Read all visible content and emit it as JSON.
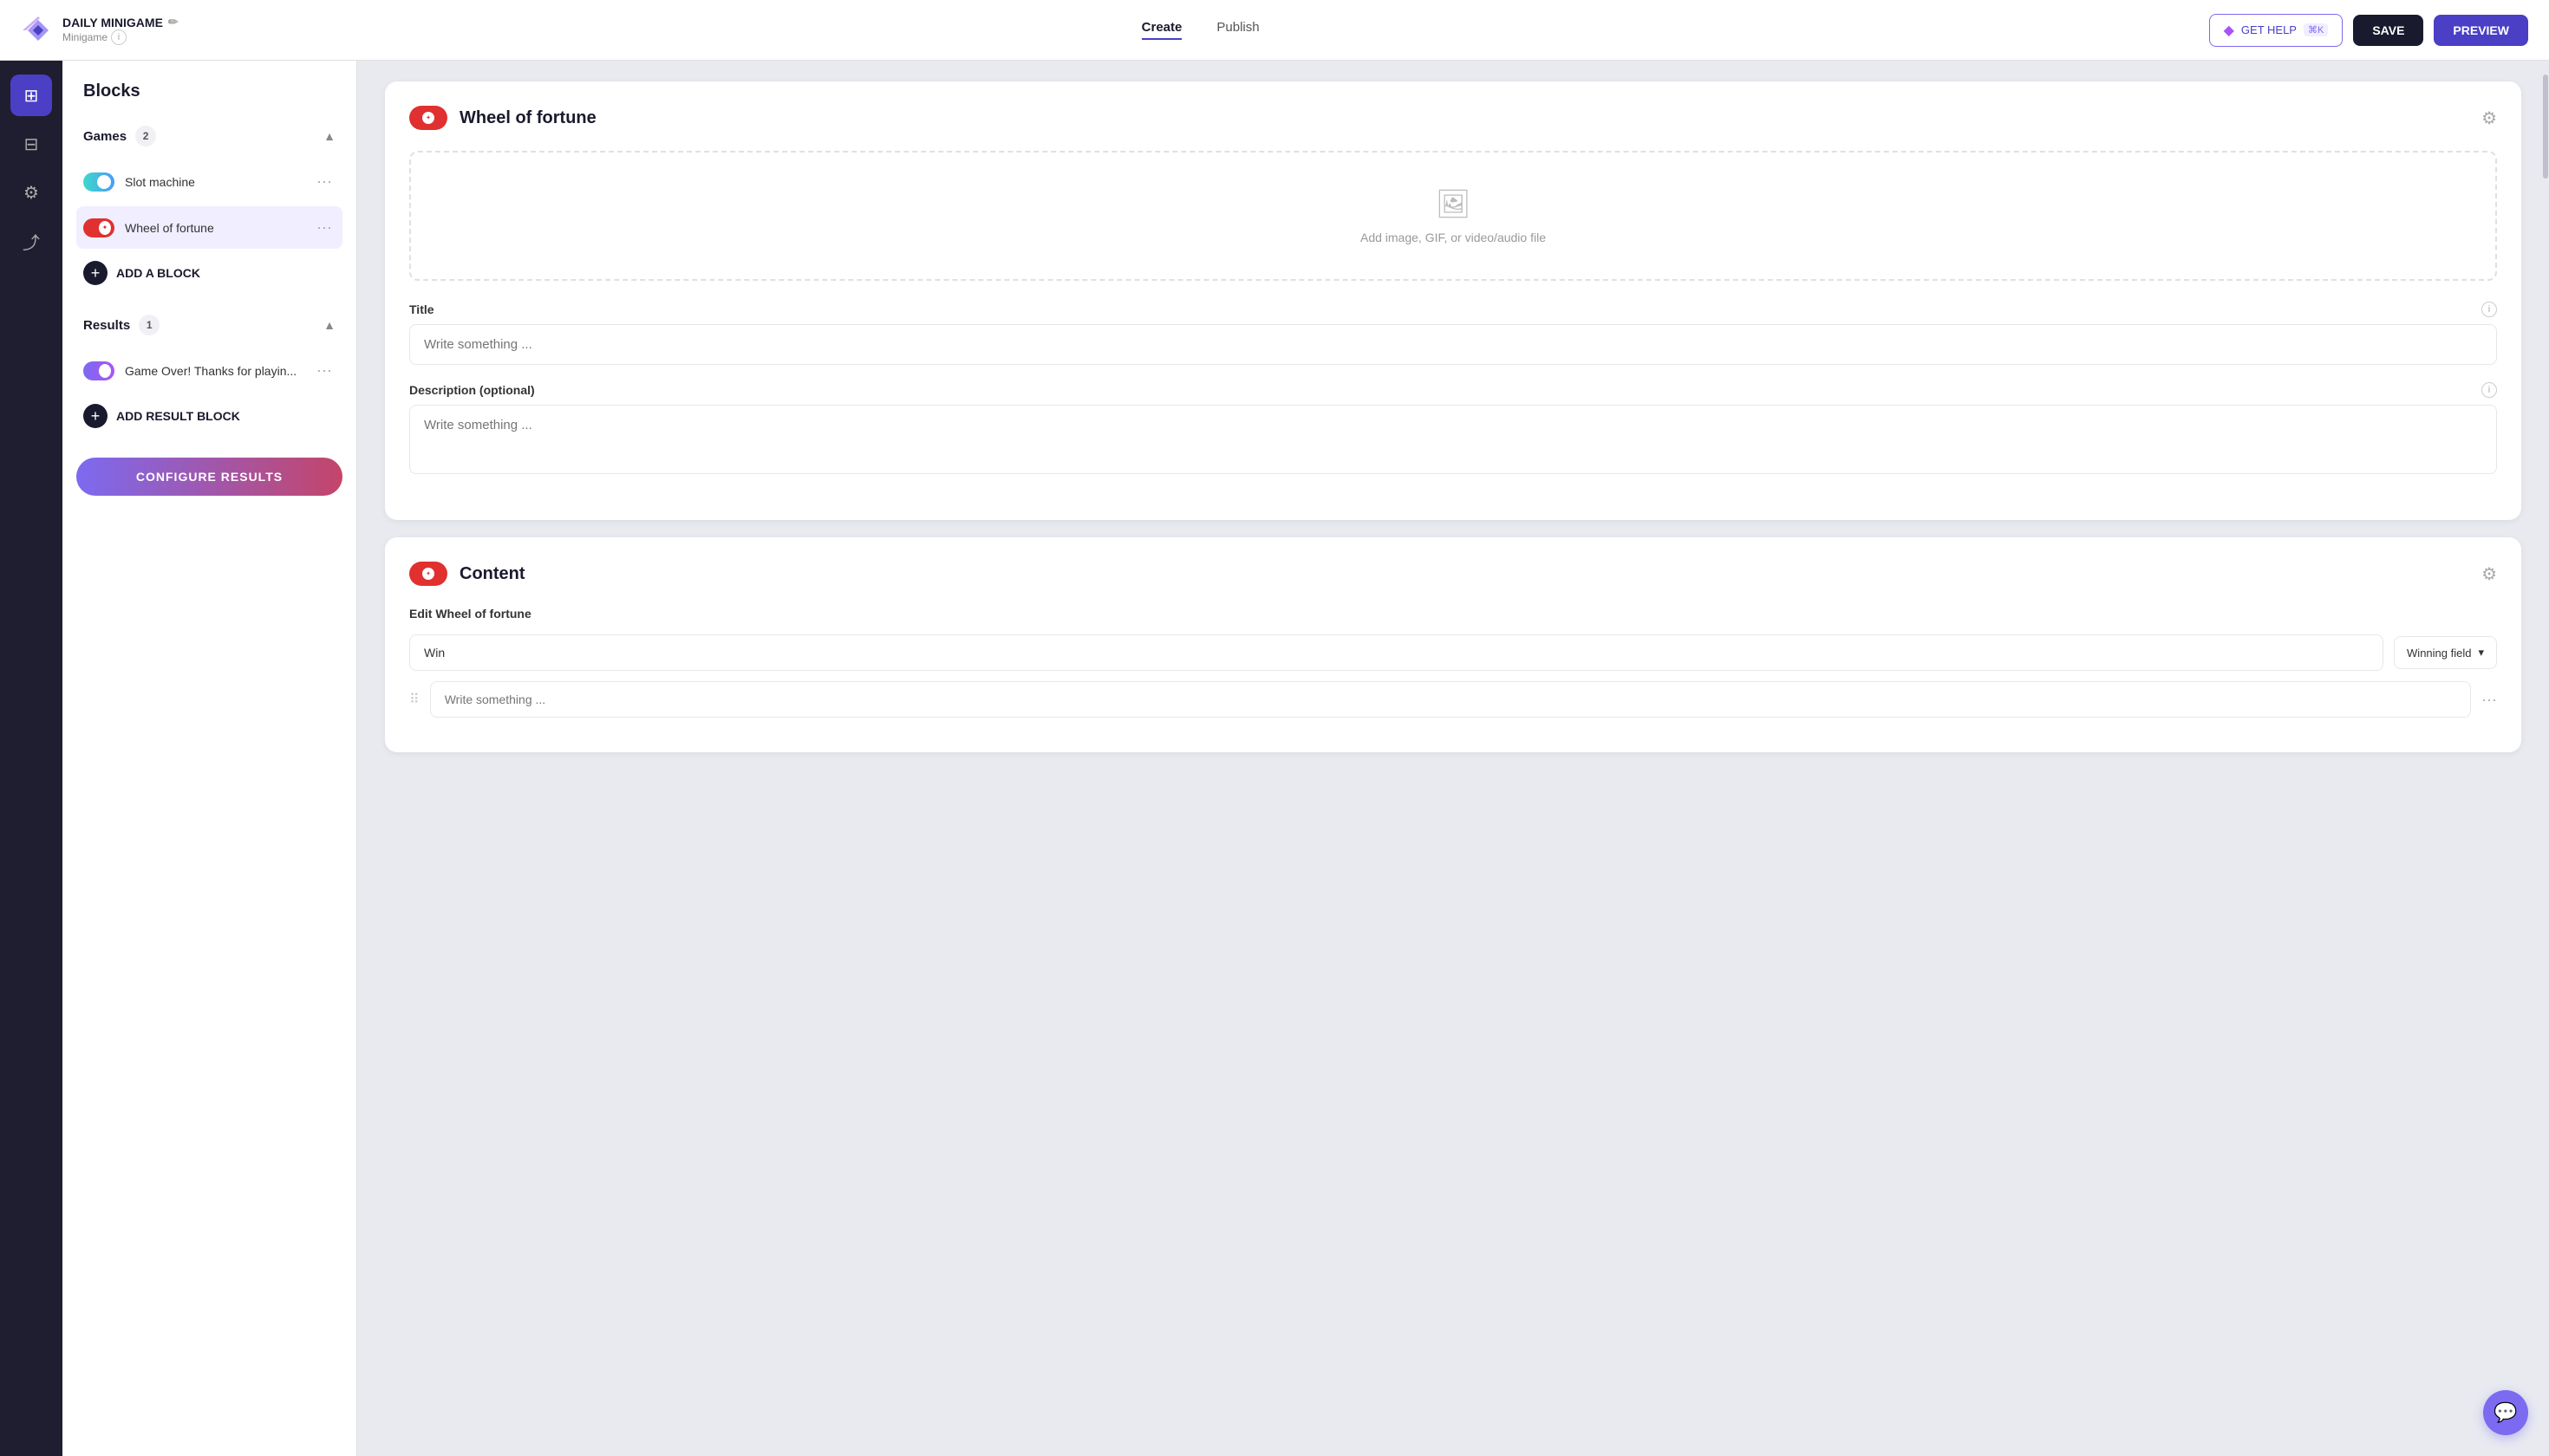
{
  "topbar": {
    "title": "DAILY MINIGAME",
    "subtitle": "Minigame",
    "create_label": "Create",
    "publish_label": "Publish",
    "help_label": "GET HELP",
    "help_shortcut": "⌘K",
    "save_label": "SAVE",
    "preview_label": "PREVIEW"
  },
  "sidebar_icons": [
    {
      "name": "blocks-icon",
      "symbol": "⊞",
      "active": true
    },
    {
      "name": "layers-icon",
      "symbol": "⊟",
      "active": false
    },
    {
      "name": "settings-icon",
      "symbol": "⚙",
      "active": false
    },
    {
      "name": "share-icon",
      "symbol": "⤴",
      "active": false
    }
  ],
  "blocks_panel": {
    "title": "Blocks",
    "games_section": {
      "label": "Games",
      "count": "2",
      "items": [
        {
          "label": "Slot machine",
          "type": "slot"
        },
        {
          "label": "Wheel of fortune",
          "type": "wheel",
          "active": true
        }
      ],
      "add_label": "ADD A BLOCK"
    },
    "results_section": {
      "label": "Results",
      "count": "1",
      "items": [
        {
          "label": "Game Over! Thanks for playin...",
          "type": "result"
        }
      ],
      "add_label": "ADD RESULT BLOCK"
    },
    "configure_label": "CONFIGURE RESULTS"
  },
  "wheel_card": {
    "title": "Wheel of fortune",
    "upload_text": "Add image, GIF, or video/audio file",
    "title_field": {
      "label": "Title",
      "placeholder": "Write something ..."
    },
    "description_field": {
      "label": "Description (optional)",
      "placeholder": "Write something ..."
    }
  },
  "content_card": {
    "title": "Content",
    "edit_label": "Edit Wheel of fortune",
    "rows": [
      {
        "input_value": "Win",
        "dropdown_label": "Winning field"
      },
      {
        "input_placeholder": "Write something ..."
      }
    ]
  }
}
